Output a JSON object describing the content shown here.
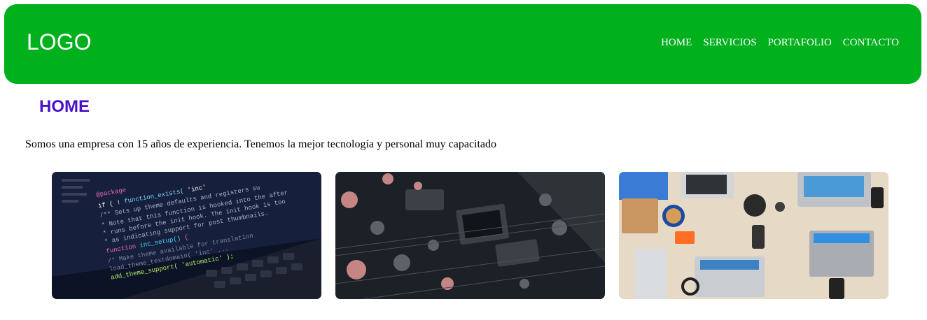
{
  "header": {
    "logo": "LOGO",
    "bg_color": "#00b01d",
    "nav": [
      "HOME",
      "SERVICIOS",
      "PORTAFOLIO",
      "CONTACTO"
    ]
  },
  "main": {
    "title": "HOME",
    "title_color": "#4b0fc9",
    "description": "Somos una empresa con 15 años de experiencia. Tenemos la mejor tecnología y personal muy capacitado"
  }
}
